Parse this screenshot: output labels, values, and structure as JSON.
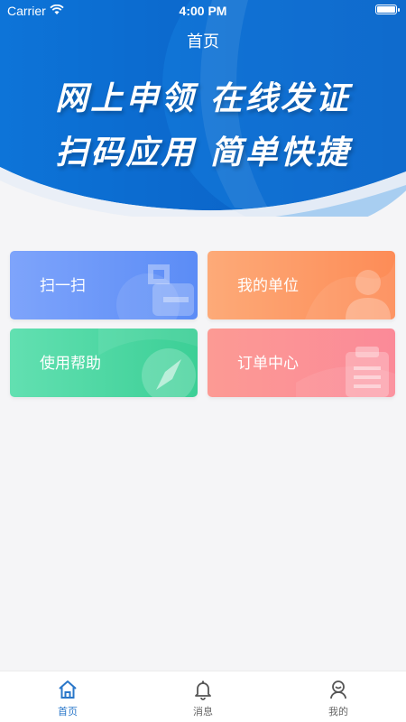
{
  "status_bar": {
    "carrier": "Carrier",
    "time": "4:00 PM"
  },
  "header": {
    "title": "首页",
    "slogan_line1": "网上申领  在线发证",
    "slogan_line2": "扫码应用  简单快捷"
  },
  "cards": {
    "scan": "扫一扫",
    "unit": "我的单位",
    "help": "使用帮助",
    "order": "订单中心"
  },
  "tabbar": {
    "home": "首页",
    "messages": "消息",
    "mine": "我的"
  },
  "colors": {
    "hero_blue": "#0a64c8",
    "active_tab": "#2a77c9"
  }
}
